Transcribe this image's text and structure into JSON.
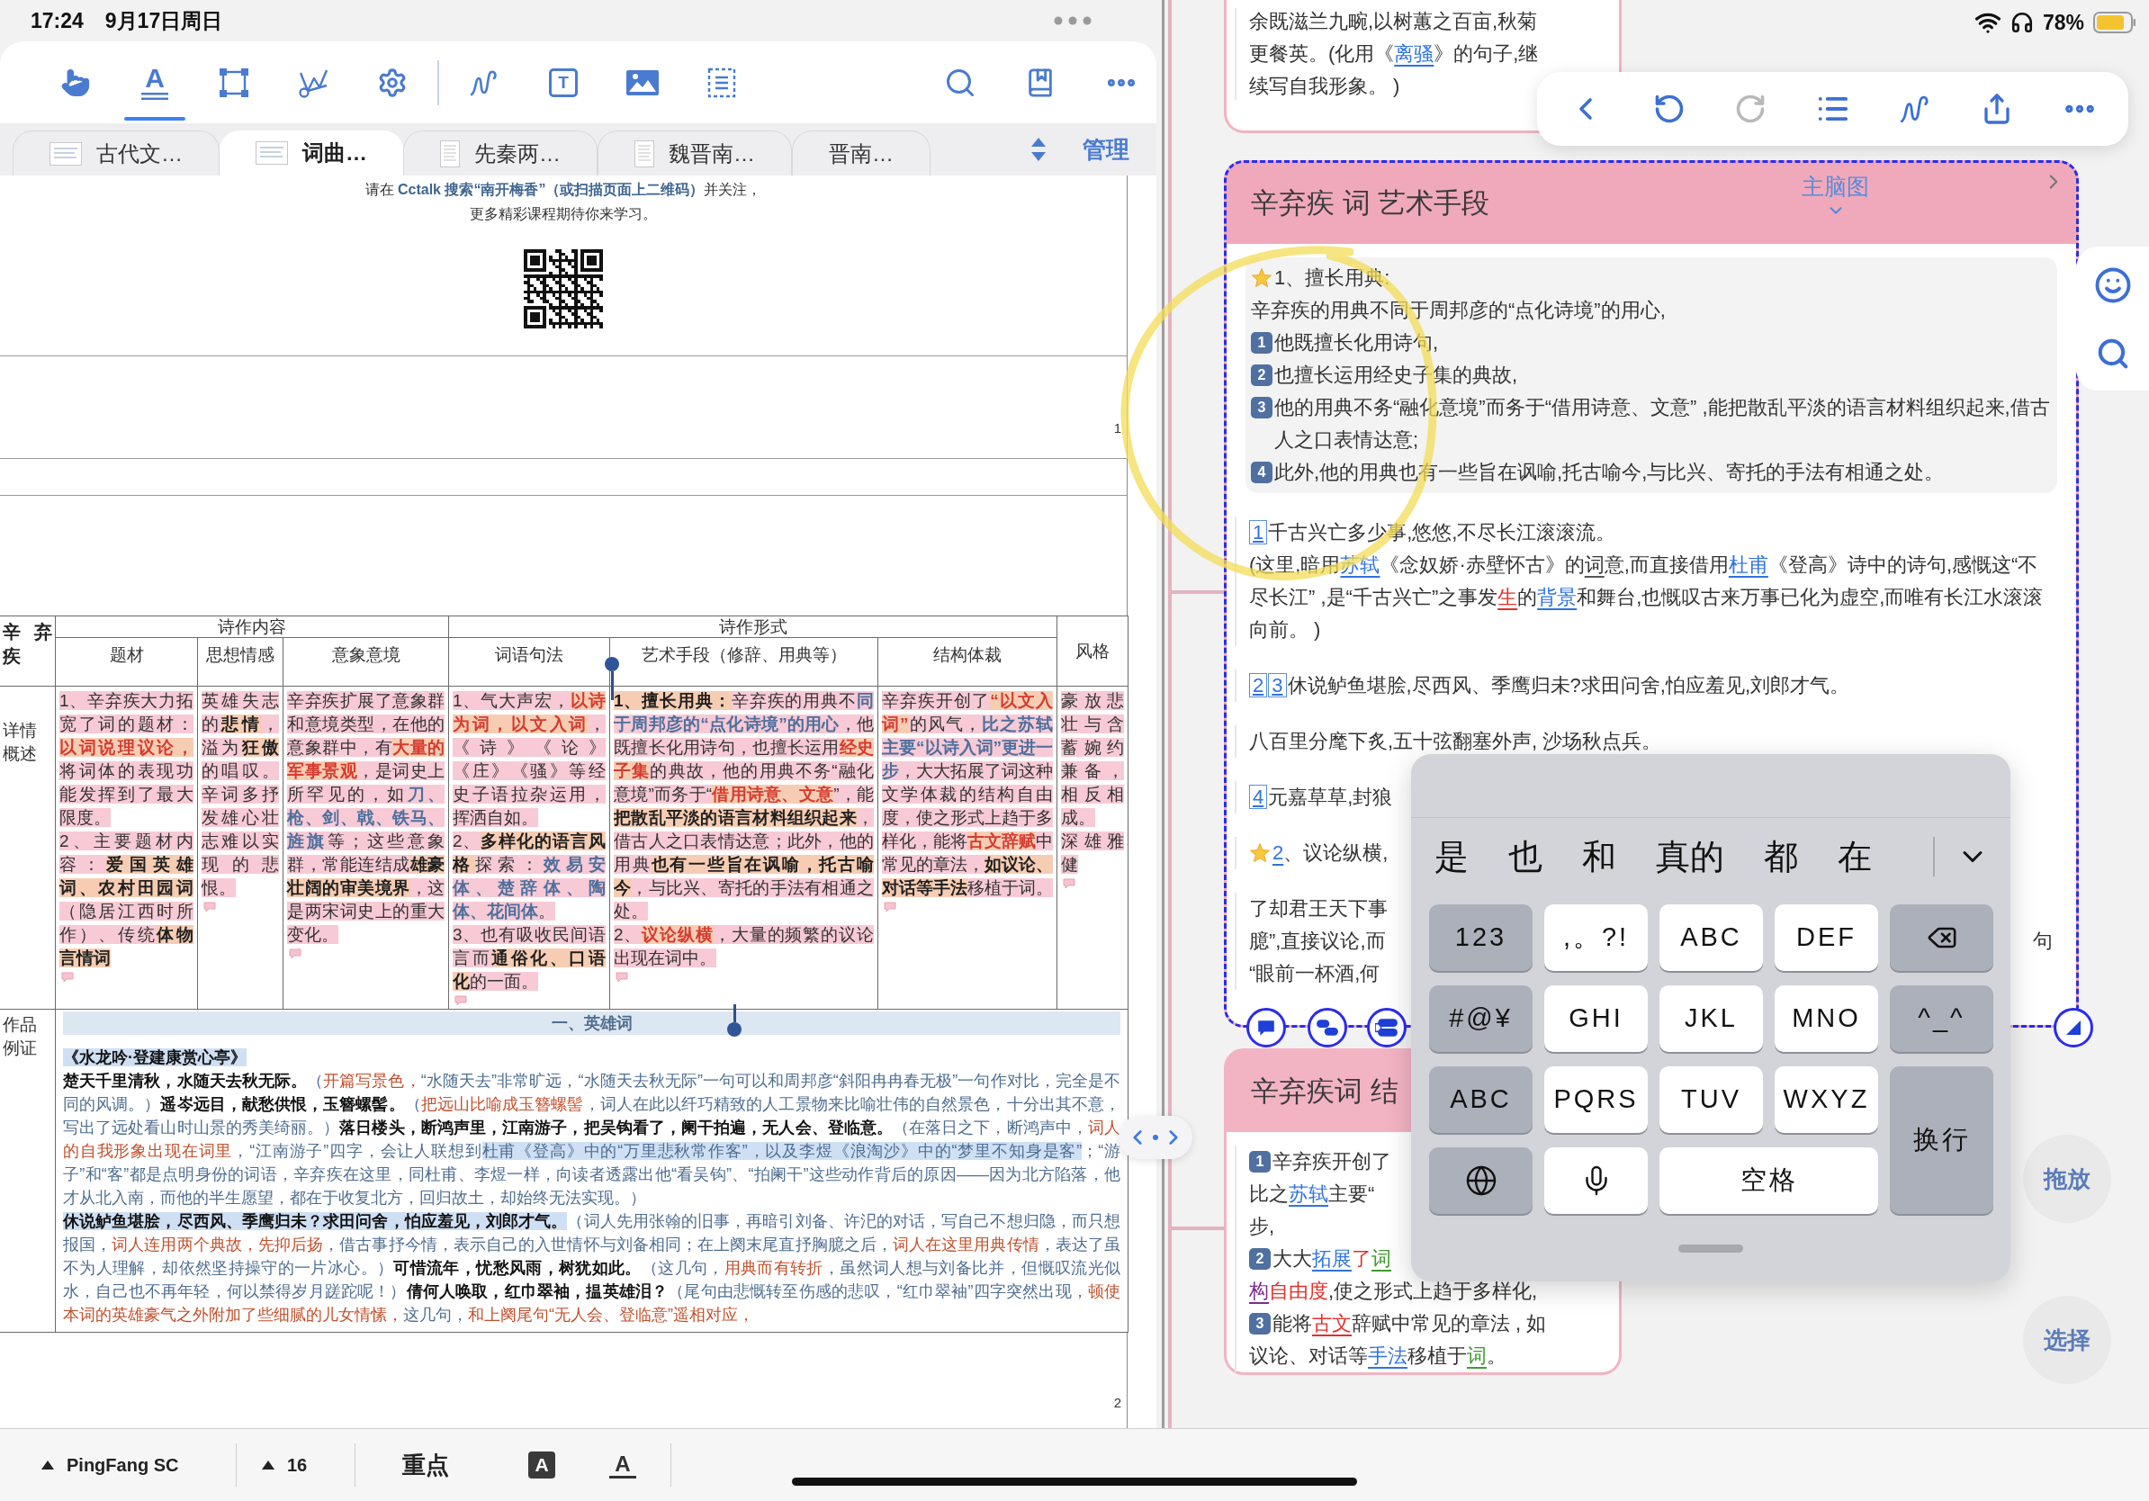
{
  "status_bar": {
    "time": "17:24",
    "date": "9月17日周日",
    "battery": "78%"
  },
  "toolbar": {
    "tools": [
      {
        "kind": "hand",
        "selected": false
      },
      {
        "kind": "text",
        "label": "A",
        "selected": true
      },
      {
        "kind": "rect",
        "selected": false
      },
      {
        "kind": "lasso",
        "selected": false
      },
      {
        "kind": "gear",
        "selected": false
      },
      {
        "kind": "squiggle",
        "selected": false
      },
      {
        "kind": "textbox",
        "label": "T",
        "selected": false
      },
      {
        "kind": "image",
        "selected": false
      },
      {
        "kind": "listbox",
        "selected": false
      }
    ],
    "actions": [
      {
        "kind": "search"
      },
      {
        "kind": "bookmark"
      },
      {
        "kind": "more"
      }
    ]
  },
  "tabs": [
    {
      "label": "古代文…",
      "kind": "landscape",
      "selected": false
    },
    {
      "label": "词曲…",
      "kind": "landscape",
      "selected": true
    },
    {
      "label": "先秦两…",
      "kind": "portrait",
      "selected": false
    },
    {
      "label": "魏晋南…",
      "kind": "portrait",
      "selected": false
    },
    {
      "label": "晋南…",
      "kind": "bare",
      "selected": false
    }
  ],
  "manage_button": "管理",
  "document": {
    "notice_lines": [
      "请在 **Cctalk 搜索“南开梅香”（或扫描页面上二维码）**并关注，",
      "更多精彩课程期待你来学习。"
    ],
    "page_numbers": [
      "1",
      "2"
    ],
    "table": {
      "corner": "辛弃疾",
      "groups": [
        {
          "label": "诗作内容",
          "columns": [
            "题材",
            "思想情感",
            "意象意境"
          ]
        },
        {
          "label": "诗作形式",
          "columns": [
            "词语句法",
            "艺术手段（修辞、用典等）",
            "结构体裁"
          ]
        }
      ],
      "ungrouped_columns": [
        "风格"
      ],
      "rows": [
        {
          "header": "详情概述",
          "cells": [
            {
              "paragraphs": [
                [
                  {
                    "text": "1、辛弃疾大力拓宽了词的题材：",
                    "kind": "plain"
                  },
                  {
                    "text": "以词说理议论，",
                    "kind": "red"
                  },
                  {
                    "text": "将词体的表现功能发挥到了最大限度。",
                    "kind": "plain"
                  }
                ],
                [
                  {
                    "text": "2、主要题材内容：",
                    "kind": "plain"
                  },
                  {
                    "text": "爱国英雄词、农村田园词",
                    "kind": "bold"
                  },
                  {
                    "text": "（隐居江西时所作）、传统",
                    "kind": "plain"
                  },
                  {
                    "text": "体物言情词",
                    "kind": "bold"
                  }
                ]
              ]
            },
            {
              "paragraphs": [
                [
                  {
                    "text": "英雄失志的",
                    "kind": "plain"
                  },
                  {
                    "text": "悲情",
                    "kind": "bold"
                  },
                  {
                    "text": "，溢为",
                    "kind": "plain"
                  },
                  {
                    "text": "狂傲",
                    "kind": "bold"
                  },
                  {
                    "text": "的唱叹。辛词多抒发雄心壮志难以实现的悲恨。",
                    "kind": "plain"
                  }
                ]
              ]
            },
            {
              "paragraphs": [
                [
                  {
                    "text": "辛弃疾扩展了意象群和意境类型，在他的意象群中，有",
                    "kind": "plain"
                  },
                  {
                    "text": "大量的军事景观",
                    "kind": "red"
                  },
                  {
                    "text": "，是词史上所罕见的，如",
                    "kind": "plain"
                  },
                  {
                    "text": "刀、枪、剑、戟、铁马、旌旗",
                    "kind": "blue"
                  },
                  {
                    "text": "等；这些意象群，常能连结成",
                    "kind": "plain"
                  },
                  {
                    "text": "雄豪壮阔的审美境界",
                    "kind": "bold"
                  },
                  {
                    "text": "，这是两宋词史上的重大变化。",
                    "kind": "plain"
                  }
                ]
              ]
            },
            {
              "paragraphs": [
                [
                  {
                    "text": "1、气大声宏，",
                    "kind": "plain"
                  },
                  {
                    "text": "以诗为词，以文入词",
                    "kind": "red"
                  },
                  {
                    "text": "，《诗》《论》《庄》《骚》等经史子语拉杂运用，挥洒自如。",
                    "kind": "plain"
                  }
                ],
                [
                  {
                    "text": "2、",
                    "kind": "plain"
                  },
                  {
                    "text": "多样化的语言风格",
                    "kind": "bold"
                  },
                  {
                    "text": "探索：",
                    "kind": "plain"
                  },
                  {
                    "text": "效易安体、楚辞体、陶体、花间体",
                    "kind": "blue"
                  },
                  {
                    "text": "。",
                    "kind": "plain"
                  }
                ],
                [
                  {
                    "text": "3、也有吸收民间语言而",
                    "kind": "plain"
                  },
                  {
                    "text": "通俗化、口语化",
                    "kind": "bold"
                  },
                  {
                    "text": "的一面。",
                    "kind": "plain"
                  }
                ]
              ]
            },
            {
              "paragraphs": [
                [
                  {
                    "text": "1、擅长用典：",
                    "kind": "bold"
                  },
                  {
                    "text": "辛弃疾的用典不",
                    "kind": "plain"
                  },
                  {
                    "text": "同于周邦彦的“点化诗境”的用心",
                    "kind": "blue"
                  },
                  {
                    "text": "，他既擅长化用诗句，也擅长运用",
                    "kind": "plain"
                  },
                  {
                    "text": "经史子集",
                    "kind": "red"
                  },
                  {
                    "text": "的典故，他的用典不务“融化意境”而务于“",
                    "kind": "plain"
                  },
                  {
                    "text": "借用诗意、文意",
                    "kind": "red"
                  },
                  {
                    "text": "”，能",
                    "kind": "plain"
                  },
                  {
                    "text": "把散乱平淡的语言材料组织起来",
                    "kind": "bold"
                  },
                  {
                    "text": "，借古人之口表情达意；此外，他的用典",
                    "kind": "plain"
                  },
                  {
                    "text": "也有一些旨在讽喻，托古喻今",
                    "kind": "bold"
                  },
                  {
                    "text": "，与比兴、寄托的手法有相通之处。",
                    "kind": "plain"
                  }
                ],
                [
                  {
                    "text": "2、",
                    "kind": "plain"
                  },
                  {
                    "text": "议论纵横",
                    "kind": "red"
                  },
                  {
                    "text": "，大量的频繁的议论出现在词中。",
                    "kind": "plain"
                  }
                ]
              ]
            },
            {
              "paragraphs": [
                [
                  {
                    "text": "辛弃疾开创了",
                    "kind": "plain"
                  },
                  {
                    "text": "“以文入词”",
                    "kind": "red"
                  },
                  {
                    "text": "的风气，",
                    "kind": "plain"
                  },
                  {
                    "text": "比之苏轼主要“以诗入词”更进一步",
                    "kind": "blue"
                  },
                  {
                    "text": "，大大拓展了词这种文学体裁的结构自由度，使之形式上趋于多样化，能将",
                    "kind": "plain"
                  },
                  {
                    "text": "古文辞赋",
                    "kind": "red"
                  },
                  {
                    "text": "中常见的章法，",
                    "kind": "plain"
                  },
                  {
                    "text": "如议论、对话等手法",
                    "kind": "bold"
                  },
                  {
                    "text": "移植于词。",
                    "kind": "plain"
                  }
                ]
              ]
            },
            {
              "paragraphs": [
                [
                  {
                    "text": "豪放悲壮与含蓄婉约兼备，相反相成。",
                    "kind": "plain"
                  }
                ],
                [
                  {
                    "text": "深雄雅健",
                    "kind": "plain"
                  }
                ]
              ]
            }
          ]
        }
      ],
      "example": {
        "header": "作品例证",
        "section": "一、英雄词",
        "title": "《水龙吟·登建康赏心亭》",
        "paragraphs": [
          [
            {
              "text": "楚天千里清秋，水随天去秋无际。",
              "kind": "poem"
            },
            {
              "text": "（",
              "kind": "note"
            },
            {
              "text": "开篇写景色，",
              "kind": "red"
            },
            {
              "text": "“水随天去”非常旷远，“水随天去秋无际”一句可以和周邦彦“斜阳冉冉春无极”一句作对比，完全是不同的风调。）",
              "kind": "note"
            },
            {
              "text": "遥岑远目，献愁供恨，玉簪螺髻。",
              "kind": "poem"
            },
            {
              "text": "（",
              "kind": "note"
            },
            {
              "text": "把远山比喻成玉簪螺髻",
              "kind": "red"
            },
            {
              "text": "，词人在此以纤巧精致的人工景物来比喻壮伟的自然景色，十分出其不意，写出了远处看山时山景的秀美绮丽。）",
              "kind": "note"
            },
            {
              "text": "落日楼头，断鸿声里，江南游子，把吴钩看了，阑干拍遍，无人会、登临意。",
              "kind": "poem"
            },
            {
              "text": "（在落日之下，断鸿声中，",
              "kind": "note"
            },
            {
              "text": "词人的自我形象出现在词里",
              "kind": "red"
            },
            {
              "text": "，“江南游子”四字，会让人联想到",
              "kind": "note"
            },
            {
              "text": "杜甫《登高》中的“万里悲秋常作客”，以及李煜《浪淘沙》中的“梦里不知身是客”",
              "kind": "notehl"
            },
            {
              "text": "；“游子”和“客”都是点明身份的词语，辛弃疾在这里，同杜甫、李煜一样，向读者透露出他“看吴钩”、“拍阑干”这些动作背后的原因——因为北方陷落，他才从北入南，而他的半生愿望，都在于收复北方，回归故土，却始终无法实现。）",
              "kind": "note"
            }
          ],
          [
            {
              "text": "休说鲈鱼堪脍，尽西风、季鹰归未？求田问舍，怕应羞见，刘郎才气。",
              "kind": "poemhl"
            },
            {
              "text": "（词人先用张翰的旧事，再暗引刘备、许汜的对话，写自己不想归隐，而只想报国，",
              "kind": "note"
            },
            {
              "text": "词人连用两个典故，先抑后扬",
              "kind": "red"
            },
            {
              "text": "，借古事抒今情，表示自己的入世情怀与刘备相同；在上阕末尾直抒胸臆之后，",
              "kind": "note"
            },
            {
              "text": "词人在这里用典传情",
              "kind": "red"
            },
            {
              "text": "，表达了虽不为人理解，却依然坚持操守的一片冰心。）",
              "kind": "note"
            },
            {
              "text": "可惜流年，忧愁风雨，树犹如此。",
              "kind": "poem"
            },
            {
              "text": "（这几句，",
              "kind": "note"
            },
            {
              "text": "用典而有转折",
              "kind": "red"
            },
            {
              "text": "，虽然词人想与刘备比并，但慨叹流光似水，自己也不再年轻，何以禁得岁月蹉跎呢！）",
              "kind": "note"
            },
            {
              "text": "倩何人唤取，红巾翠袖，揾英雄泪？",
              "kind": "poem"
            },
            {
              "text": "（尾句由悲慨转至伤感的悲叹，“红巾翠袖”四字突然出现，",
              "kind": "note"
            },
            {
              "text": "顿使本词的英雄豪气之外附加了些细腻的儿女情愫，",
              "kind": "red"
            },
            {
              "text": "这几句，",
              "kind": "note"
            },
            {
              "text": "和上阕尾句“无人会、登临意”遥相对应，",
              "kind": "red"
            }
          ]
        ]
      }
    }
  },
  "format_bar": {
    "font": "PingFang SC",
    "size": "16",
    "emphasis": "重点",
    "text_styles": [
      {
        "kind": "filled",
        "label": "A"
      },
      {
        "kind": "underlined",
        "label": "A"
      }
    ]
  },
  "note_cards": [
    {
      "selected": false,
      "expanded": false,
      "blocks": [
        [
          {
            "kind": "plain",
            "segments": [
              {
                "text": "余既滋兰九畹,以树蕙之百亩,秋菊",
                "kind": "plain"
              }
            ]
          },
          {
            "kind": "plain",
            "segments": [
              {
                "text": "更餐英。(化用《",
                "kind": "plain"
              },
              {
                "text": "离骚",
                "kind": "link"
              },
              {
                "text": "》的句子,继",
                "kind": "plain"
              }
            ]
          },
          {
            "kind": "plain",
            "segments": [
              {
                "text": "续写自我形象。 )",
                "kind": "plain"
              }
            ]
          }
        ]
      ]
    },
    {
      "selected": true,
      "expanded": true,
      "title": "辛弃疾 词 艺术手段",
      "mind_map_label": "主脑图",
      "summary": [
        {
          "kind": "star",
          "segments": [
            {
              "text": "1、擅长用典:",
              "kind": "plain"
            }
          ]
        },
        {
          "kind": "plain",
          "segments": [
            {
              "text": "辛弃疾的用典不同于周邦彦的“点化诗境”的用心,",
              "kind": "plain"
            }
          ]
        },
        {
          "kind": "numbered",
          "badge": "1",
          "segments": [
            {
              "text": "他既擅长化用诗句,",
              "kind": "plain"
            }
          ]
        },
        {
          "kind": "numbered",
          "badge": "2",
          "segments": [
            {
              "text": "也擅长运用经史子集的典故,",
              "kind": "plain"
            }
          ]
        },
        {
          "kind": "numbered",
          "badge": "3",
          "segments": [
            {
              "text": "他的用典不务“融化意境”而务于“借用诗意、文意” ,能把散乱平淡的语言材料组织起来,借古人之口表情达意;",
              "kind": "plain"
            }
          ]
        },
        {
          "kind": "numbered",
          "badge": "4",
          "segments": [
            {
              "text": "此外,他的用典也有一些旨在讽喻,托古喻今,与比兴、寄托的手法有相通之处。",
              "kind": "plain"
            }
          ]
        }
      ],
      "blocks": [
        [
          {
            "kind": "plain",
            "segments": [
              {
                "text": "1",
                "kind": "ref"
              },
              {
                "text": "千古兴亡多少事,悠悠,不尽长江滚滚流。",
                "kind": "plain"
              }
            ]
          },
          {
            "kind": "plain",
            "segments": [
              {
                "text": "(这里,暗用",
                "kind": "plain"
              },
              {
                "text": "苏轼",
                "kind": "link"
              },
              {
                "text": "《念奴娇·赤壁怀古》的",
                "kind": "plain"
              },
              {
                "text": "词",
                "kind": "graylink"
              },
              {
                "text": "意,而直接借用",
                "kind": "plain"
              },
              {
                "text": "杜甫",
                "kind": "link"
              },
              {
                "text": "《登高》诗中的诗句,感慨这“不尽长江” ,是“千古兴亡”之事发",
                "kind": "plain"
              },
              {
                "text": "生",
                "kind": "redlink"
              },
              {
                "text": "的",
                "kind": "plain"
              },
              {
                "text": "背景",
                "kind": "link"
              },
              {
                "text": "和舞台,也慨叹古来万事已化为虚空,而唯有长江水滚滚向前。 )",
                "kind": "plain"
              }
            ]
          }
        ],
        [
          {
            "kind": "plain",
            "segments": [
              {
                "text": "2",
                "kind": "ref"
              },
              {
                "text": "3",
                "kind": "ref"
              },
              {
                "text": "休说鲈鱼堪脍,尽西风、季鹰归未?求田问舍,怕应羞见,刘郎才气。",
                "kind": "plain"
              }
            ]
          }
        ],
        [
          {
            "kind": "plain",
            "segments": [
              {
                "text": "八百里分麾下炙,五十弦翻塞外声, 沙场秋点兵。",
                "kind": "plain"
              }
            ]
          }
        ],
        [
          {
            "kind": "plain",
            "segments": [
              {
                "text": "4",
                "kind": "ref"
              },
              {
                "text": "元嘉草草,封狼",
                "kind": "plain"
              }
            ]
          }
        ],
        [
          {
            "kind": "star",
            "segments": [
              {
                "text": "2",
                "kind": "link"
              },
              {
                "text": "、议论纵横,",
                "kind": "plain"
              }
            ]
          }
        ],
        [
          {
            "kind": "plain",
            "segments": [
              {
                "text": "了却君王天下事",
                "kind": "plain"
              }
            ]
          },
          {
            "kind": "plain",
            "segments": [
              {
                "text": "臆”,直接议论,而",
                "kind": "plain"
              }
            ],
            "trailing": "句"
          },
          {
            "kind": "plain",
            "segments": [
              {
                "text": "“眼前一杯酒,何",
                "kind": "plain"
              }
            ]
          }
        ]
      ]
    },
    {
      "selected": false,
      "expanded": false,
      "title": "辛弃疾词 结",
      "blocks": [
        [
          {
            "kind": "numbered",
            "badge": "1",
            "segments": [
              {
                "text": "辛弃疾开创了",
                "kind": "plain"
              }
            ]
          },
          {
            "kind": "plain",
            "segments": [
              {
                "text": "比之",
                "kind": "plain"
              },
              {
                "text": "苏轼",
                "kind": "link"
              },
              {
                "text": "主要“",
                "kind": "plain"
              }
            ]
          },
          {
            "kind": "plain",
            "segments": [
              {
                "text": "步,",
                "kind": "plain"
              }
            ]
          },
          {
            "kind": "numbered",
            "badge": "2",
            "segments": [
              {
                "text": "大大",
                "kind": "plain"
              },
              {
                "text": "拓展",
                "kind": "link"
              },
              {
                "text": "了",
                "kind": "red"
              },
              {
                "text": "词",
                "kind": "greenlink"
              }
            ]
          },
          {
            "kind": "plain",
            "segments": [
              {
                "text": "构",
                "kind": "purplelink"
              },
              {
                "text": "自由度",
                "kind": "red"
              },
              {
                "text": ",使之形式上趋于多样化,",
                "kind": "plain"
              }
            ]
          },
          {
            "kind": "numbered",
            "badge": "3",
            "segments": [
              {
                "text": "能将",
                "kind": "plain"
              },
              {
                "text": "古文",
                "kind": "redlink"
              },
              {
                "text": "辞赋中常见的章法 , 如",
                "kind": "plain"
              }
            ]
          },
          {
            "kind": "plain",
            "segments": [
              {
                "text": "议论、对话等",
                "kind": "plain"
              },
              {
                "text": "手法",
                "kind": "link"
              },
              {
                "text": "移植于",
                "kind": "plain"
              },
              {
                "text": "词",
                "kind": "greenlink"
              },
              {
                "text": "。",
                "kind": "plain"
              }
            ]
          }
        ]
      ]
    }
  ],
  "floating_toolbar": {
    "buttons": [
      {
        "kind": "back",
        "disabled": false
      },
      {
        "kind": "undo",
        "disabled": false
      },
      {
        "kind": "redo",
        "disabled": true
      },
      {
        "kind": "outline",
        "disabled": false
      },
      {
        "kind": "pen",
        "disabled": false
      },
      {
        "kind": "share",
        "disabled": false
      },
      {
        "kind": "more",
        "disabled": false
      }
    ]
  },
  "side_tools": [
    {
      "kind": "emoji"
    },
    {
      "kind": "search"
    }
  ],
  "mode_buttons": [
    {
      "label": "拖放"
    },
    {
      "label": "选择"
    }
  ],
  "keyboard": {
    "candidates": [
      "是",
      "也",
      "和",
      "真的",
      "都",
      "在"
    ],
    "keys": [
      {
        "kind": "function",
        "label": "123"
      },
      {
        "kind": "letter",
        "label": ",。?!"
      },
      {
        "kind": "letter",
        "label": "ABC"
      },
      {
        "kind": "letter",
        "label": "DEF"
      },
      {
        "kind": "delete"
      },
      {
        "kind": "function",
        "label": "#@¥"
      },
      {
        "kind": "letter",
        "label": "GHI"
      },
      {
        "kind": "letter",
        "label": "JKL"
      },
      {
        "kind": "letter",
        "label": "MNO"
      },
      {
        "kind": "function",
        "label": "^_^"
      },
      {
        "kind": "function",
        "label": "ABC"
      },
      {
        "kind": "letter",
        "label": "PQRS"
      },
      {
        "kind": "letter",
        "label": "TUV"
      },
      {
        "kind": "letter",
        "label": "WXYZ"
      },
      {
        "kind": "return",
        "label": "换行"
      },
      {
        "kind": "globe"
      },
      {
        "kind": "mic"
      },
      {
        "kind": "space",
        "label": "空格"
      }
    ]
  }
}
